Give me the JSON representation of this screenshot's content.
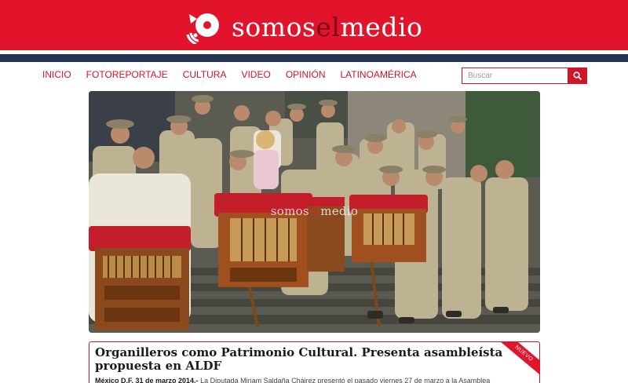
{
  "site": {
    "logo_pre": "somos",
    "logo_highlight": "el",
    "logo_post": "medio"
  },
  "nav": {
    "items": [
      {
        "label": "INICIO"
      },
      {
        "label": "FOTOREPORTAJE"
      },
      {
        "label": "CULTURA"
      },
      {
        "label": "VIDEO"
      },
      {
        "label": "OPINIÓN"
      },
      {
        "label": "LATINOAMÉRICA"
      }
    ]
  },
  "search": {
    "placeholder": "Buscar",
    "icon": "search-icon"
  },
  "hero": {
    "watermark_pre": "somos",
    "watermark_highlight": "el",
    "watermark_post": "medio"
  },
  "article": {
    "title": "Organilleros como Patrimonio Cultural. Presenta asambleísta propuesta en ALDF",
    "dateline": "México D.F. 31 de marzo 2014.-",
    "excerpt": " La Diputada Miriam Saldaña Cháirez presentó el pasado viernes 27 de marzo a la Asamblea",
    "badge": "NUEVO"
  },
  "colors": {
    "brand_red": "#e2142b",
    "dark_stripe": "#233556",
    "logo_highlight": "#7d0b18"
  }
}
